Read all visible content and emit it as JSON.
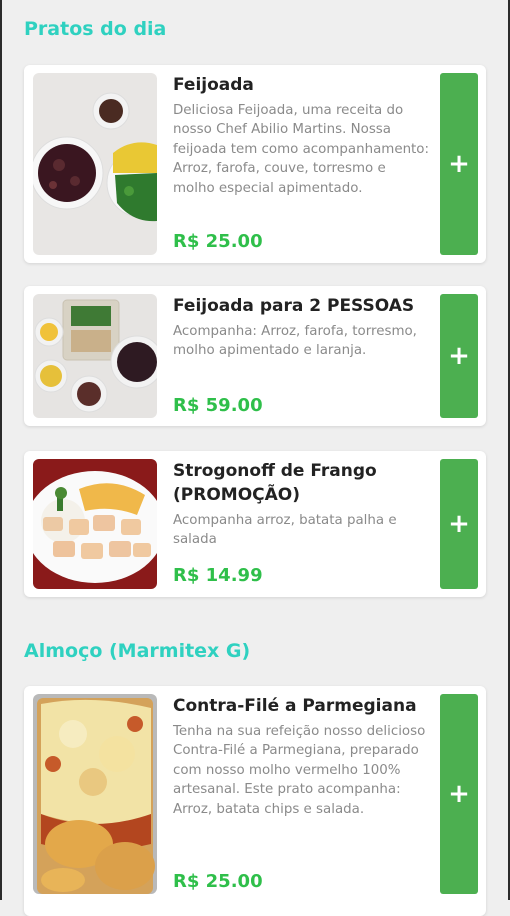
{
  "sections": [
    {
      "title": "Pratos do dia",
      "items": [
        {
          "name": "Feijoada",
          "description": "Deliciosa Feijoada, uma receita do nosso Chef Abilio Martins. Nossa feijoada tem como acompanhamento: Arroz, farofa, couve, torresmo e molho especial apimentado.",
          "price": "R$ 25.00",
          "add_label": "+"
        },
        {
          "name": "Feijoada para 2 PESSOAS",
          "description": "Acompanha: Arroz, farofa, torresmo, molho apimentado e laranja.",
          "price": "R$ 59.00",
          "add_label": "+"
        },
        {
          "name": "Strogonoff de Frango (PROMOÇÃO)",
          "description": "Acompanha arroz, batata palha e salada",
          "price": "R$ 14.99",
          "add_label": "+"
        }
      ]
    },
    {
      "title": "Almoço (Marmitex G)",
      "items": [
        {
          "name": "Contra-Filé a Parmegiana",
          "description": "Tenha na sua refeição nosso delicioso Contra-Filé a Parmegiana, preparado com nosso molho vermelho 100% artesanal. Este prato acompanha: Arroz, batata chips e salada.",
          "price": "R$ 25.00",
          "add_label": "+"
        }
      ]
    }
  ],
  "colors": {
    "section_title": "#2fd1c0",
    "price": "#2fbf4a",
    "add_button": "#4caf50"
  }
}
